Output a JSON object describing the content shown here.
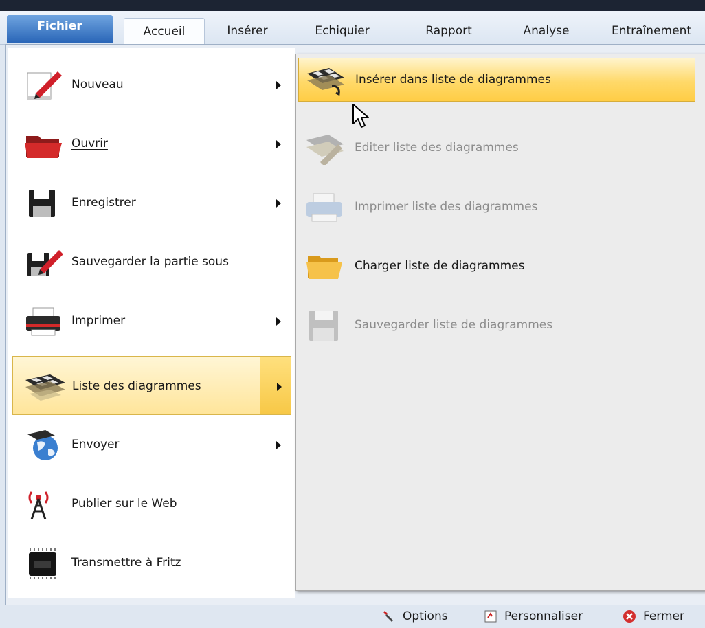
{
  "ribbon": {
    "tabs": {
      "file": "Fichier",
      "home": "Accueil",
      "insert": "Insérer",
      "board": "Echiquier",
      "report": "Rapport",
      "analysis": "Analyse",
      "training": "Entraînement"
    }
  },
  "menu": {
    "items": [
      {
        "label": "Nouveau",
        "has_submenu": true,
        "icon": "new-document-icon"
      },
      {
        "label": "Ouvrir",
        "has_submenu": true,
        "icon": "open-folder-icon"
      },
      {
        "label": "Enregistrer",
        "has_submenu": true,
        "icon": "save-icon"
      },
      {
        "label": "Sauvegarder la partie sous",
        "has_submenu": false,
        "icon": "save-as-icon"
      },
      {
        "label": "Imprimer",
        "has_submenu": true,
        "icon": "printer-icon"
      },
      {
        "label": "Liste des diagrammes",
        "has_submenu": true,
        "icon": "diagram-board-icon",
        "highlighted": true
      },
      {
        "label": "Envoyer",
        "has_submenu": true,
        "icon": "send-globe-icon"
      },
      {
        "label": "Publier sur le Web",
        "has_submenu": false,
        "icon": "antenna-icon"
      },
      {
        "label": "Transmettre à Fritz",
        "has_submenu": false,
        "icon": "chip-icon"
      }
    ]
  },
  "submenu": {
    "items": [
      {
        "label": "Insérer dans liste de diagrammes",
        "enabled": true,
        "highlighted": true,
        "icon": "insert-diagram-icon"
      },
      {
        "label": "Editer liste des diagrammes",
        "enabled": false,
        "icon": "edit-diagram-icon"
      },
      {
        "label": "Imprimer liste des diagrammes",
        "enabled": false,
        "icon": "print-diagram-icon"
      },
      {
        "label": "Charger liste de diagrammes",
        "enabled": true,
        "icon": "load-folder-icon"
      },
      {
        "label": "Sauvegarder liste de diagrammes",
        "enabled": false,
        "icon": "save-disk-icon"
      }
    ]
  },
  "footer": {
    "options": "Options",
    "customize": "Personnaliser",
    "close": "Fermer"
  },
  "colors": {
    "highlight": "#ffd969",
    "file_tab": "#2a66b8",
    "disabled_text": "#8c8c8c"
  }
}
